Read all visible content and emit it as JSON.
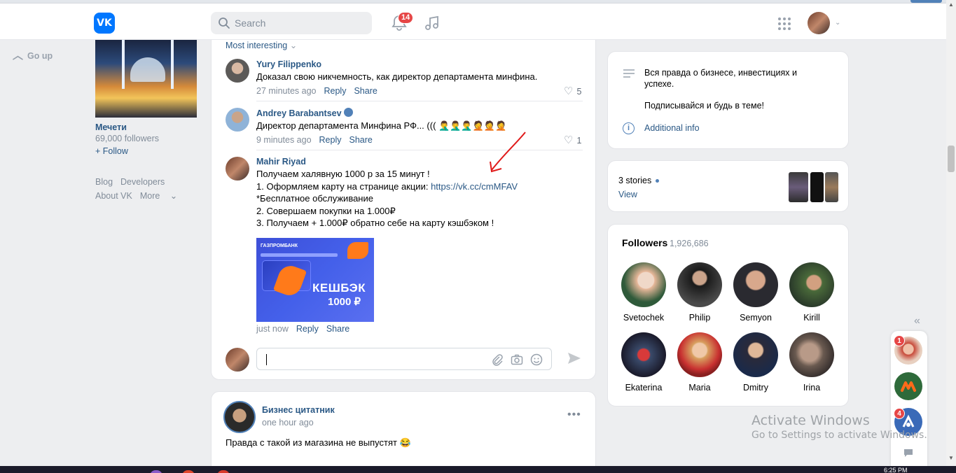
{
  "header": {
    "logo": "VK",
    "search_placeholder": "Search",
    "notifications_count": "14"
  },
  "left": {
    "go_up": "Go up",
    "group_name": "Мечети",
    "group_followers": "69,000 followers",
    "follow": "+ Follow",
    "footer": {
      "blog": "Blog",
      "developers": "Developers",
      "about": "About VK",
      "more": "More"
    }
  },
  "comments": {
    "sort_label": "Most interesting",
    "items": [
      {
        "author": "Yury Filippenko",
        "text": "Доказал свою никчемность, как директор департамента минфина.",
        "time": "27 minutes ago",
        "reply": "Reply",
        "share": "Share",
        "likes": "5"
      },
      {
        "author": "Andrey Barabantsev",
        "text": "Директор департамента Минфина РФ... ((( 🤦‍♂️🤦‍♂️🤦‍♂️🤦🤦🤦",
        "time": "9 minutes ago",
        "reply": "Reply",
        "share": "Share",
        "likes": "1"
      },
      {
        "author": "Mahir Riyad",
        "line1": "Получаем халявную 1000 р за 15 минут !",
        "line2_prefix": "1. Оформляем карту на странице акции: ",
        "line2_link": "https://vk.cc/cmMFAV",
        "line3": "*Бесплатное обслуживание",
        "line4": "2. Совершаем покупки на 1.000₽",
        "line5": "3. Получаем + 1.000₽ обратно себе на карту кэшбэком !",
        "image_brand": "ГАЗПРОМБАНК",
        "image_cashback": "КЕШБЭК",
        "image_amount": "1000 ₽",
        "time": "just now",
        "reply": "Reply",
        "share": "Share"
      }
    ]
  },
  "post": {
    "author": "Бизнес цитатник",
    "time": "one hour ago",
    "text": "Правда с такой из магазина не выпустят 😂"
  },
  "right": {
    "info_line1": "Вся правда о бизнесе, инвестициях и успехе.",
    "info_line2": "Подписывайся и будь в теме!",
    "additional_info": "Additional info",
    "stories_count": "3 stories",
    "stories_view": "View",
    "followers_label": "Followers",
    "followers_count": "1,926,686",
    "followers": [
      {
        "name": "Svetochek"
      },
      {
        "name": "Philip"
      },
      {
        "name": "Semyon"
      },
      {
        "name": "Kirill"
      },
      {
        "name": "Ekaterina"
      },
      {
        "name": "Maria"
      },
      {
        "name": "Dmitry"
      },
      {
        "name": "Irina"
      }
    ]
  },
  "chats": {
    "badge1": "1",
    "badge2": "4"
  },
  "windows": {
    "activate_title": "Activate Windows",
    "activate_sub": "Go to Settings to activate Windows.",
    "clock": "6:25 PM"
  }
}
